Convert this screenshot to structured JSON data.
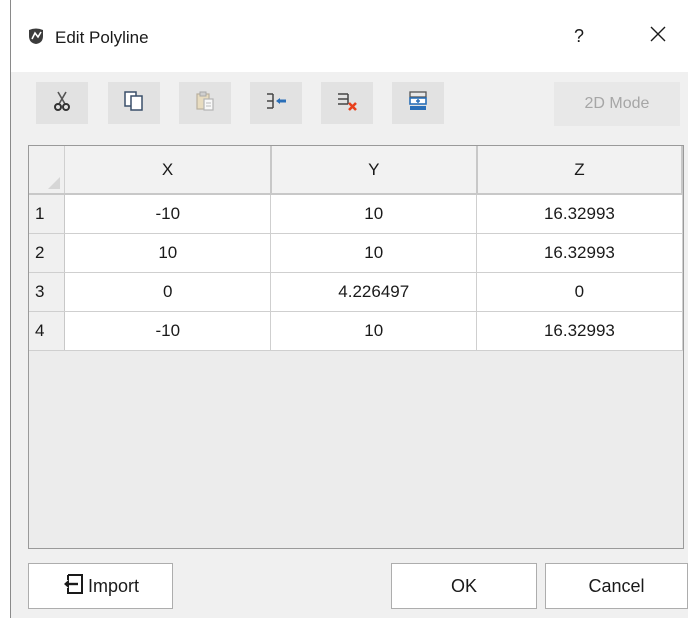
{
  "window": {
    "title": "Edit Polyline",
    "help_label": "?",
    "close_icon": "close-icon",
    "app_icon": "polyline-app-icon"
  },
  "toolbar": {
    "buttons": [
      {
        "name": "cut",
        "icon": "scissors-icon"
      },
      {
        "name": "copy",
        "icon": "copy-icon"
      },
      {
        "name": "paste",
        "icon": "paste-icon"
      },
      {
        "name": "insert-row",
        "icon": "insert-row-icon"
      },
      {
        "name": "delete-row",
        "icon": "delete-row-icon"
      },
      {
        "name": "append-row",
        "icon": "append-row-icon"
      }
    ],
    "mode_label": "2D Mode"
  },
  "grid": {
    "columns": [
      "X",
      "Y",
      "Z"
    ],
    "rows": [
      {
        "index": "1",
        "x": "-10",
        "y": "10",
        "z": "16.32993"
      },
      {
        "index": "2",
        "x": "10",
        "y": "10",
        "z": "16.32993"
      },
      {
        "index": "3",
        "x": "0",
        "y": "4.226497",
        "z": "0"
      },
      {
        "index": "4",
        "x": "-10",
        "y": "10",
        "z": "16.32993"
      }
    ]
  },
  "footer": {
    "import_label": "Import",
    "ok_label": "OK",
    "cancel_label": "Cancel"
  },
  "colors": {
    "dialog_bg": "#f0f0f0",
    "toolbar_button_bg": "#e2e2e2",
    "delete_accent": "#e8401c",
    "toolbar_icon_blue": "#2a6fb8"
  }
}
